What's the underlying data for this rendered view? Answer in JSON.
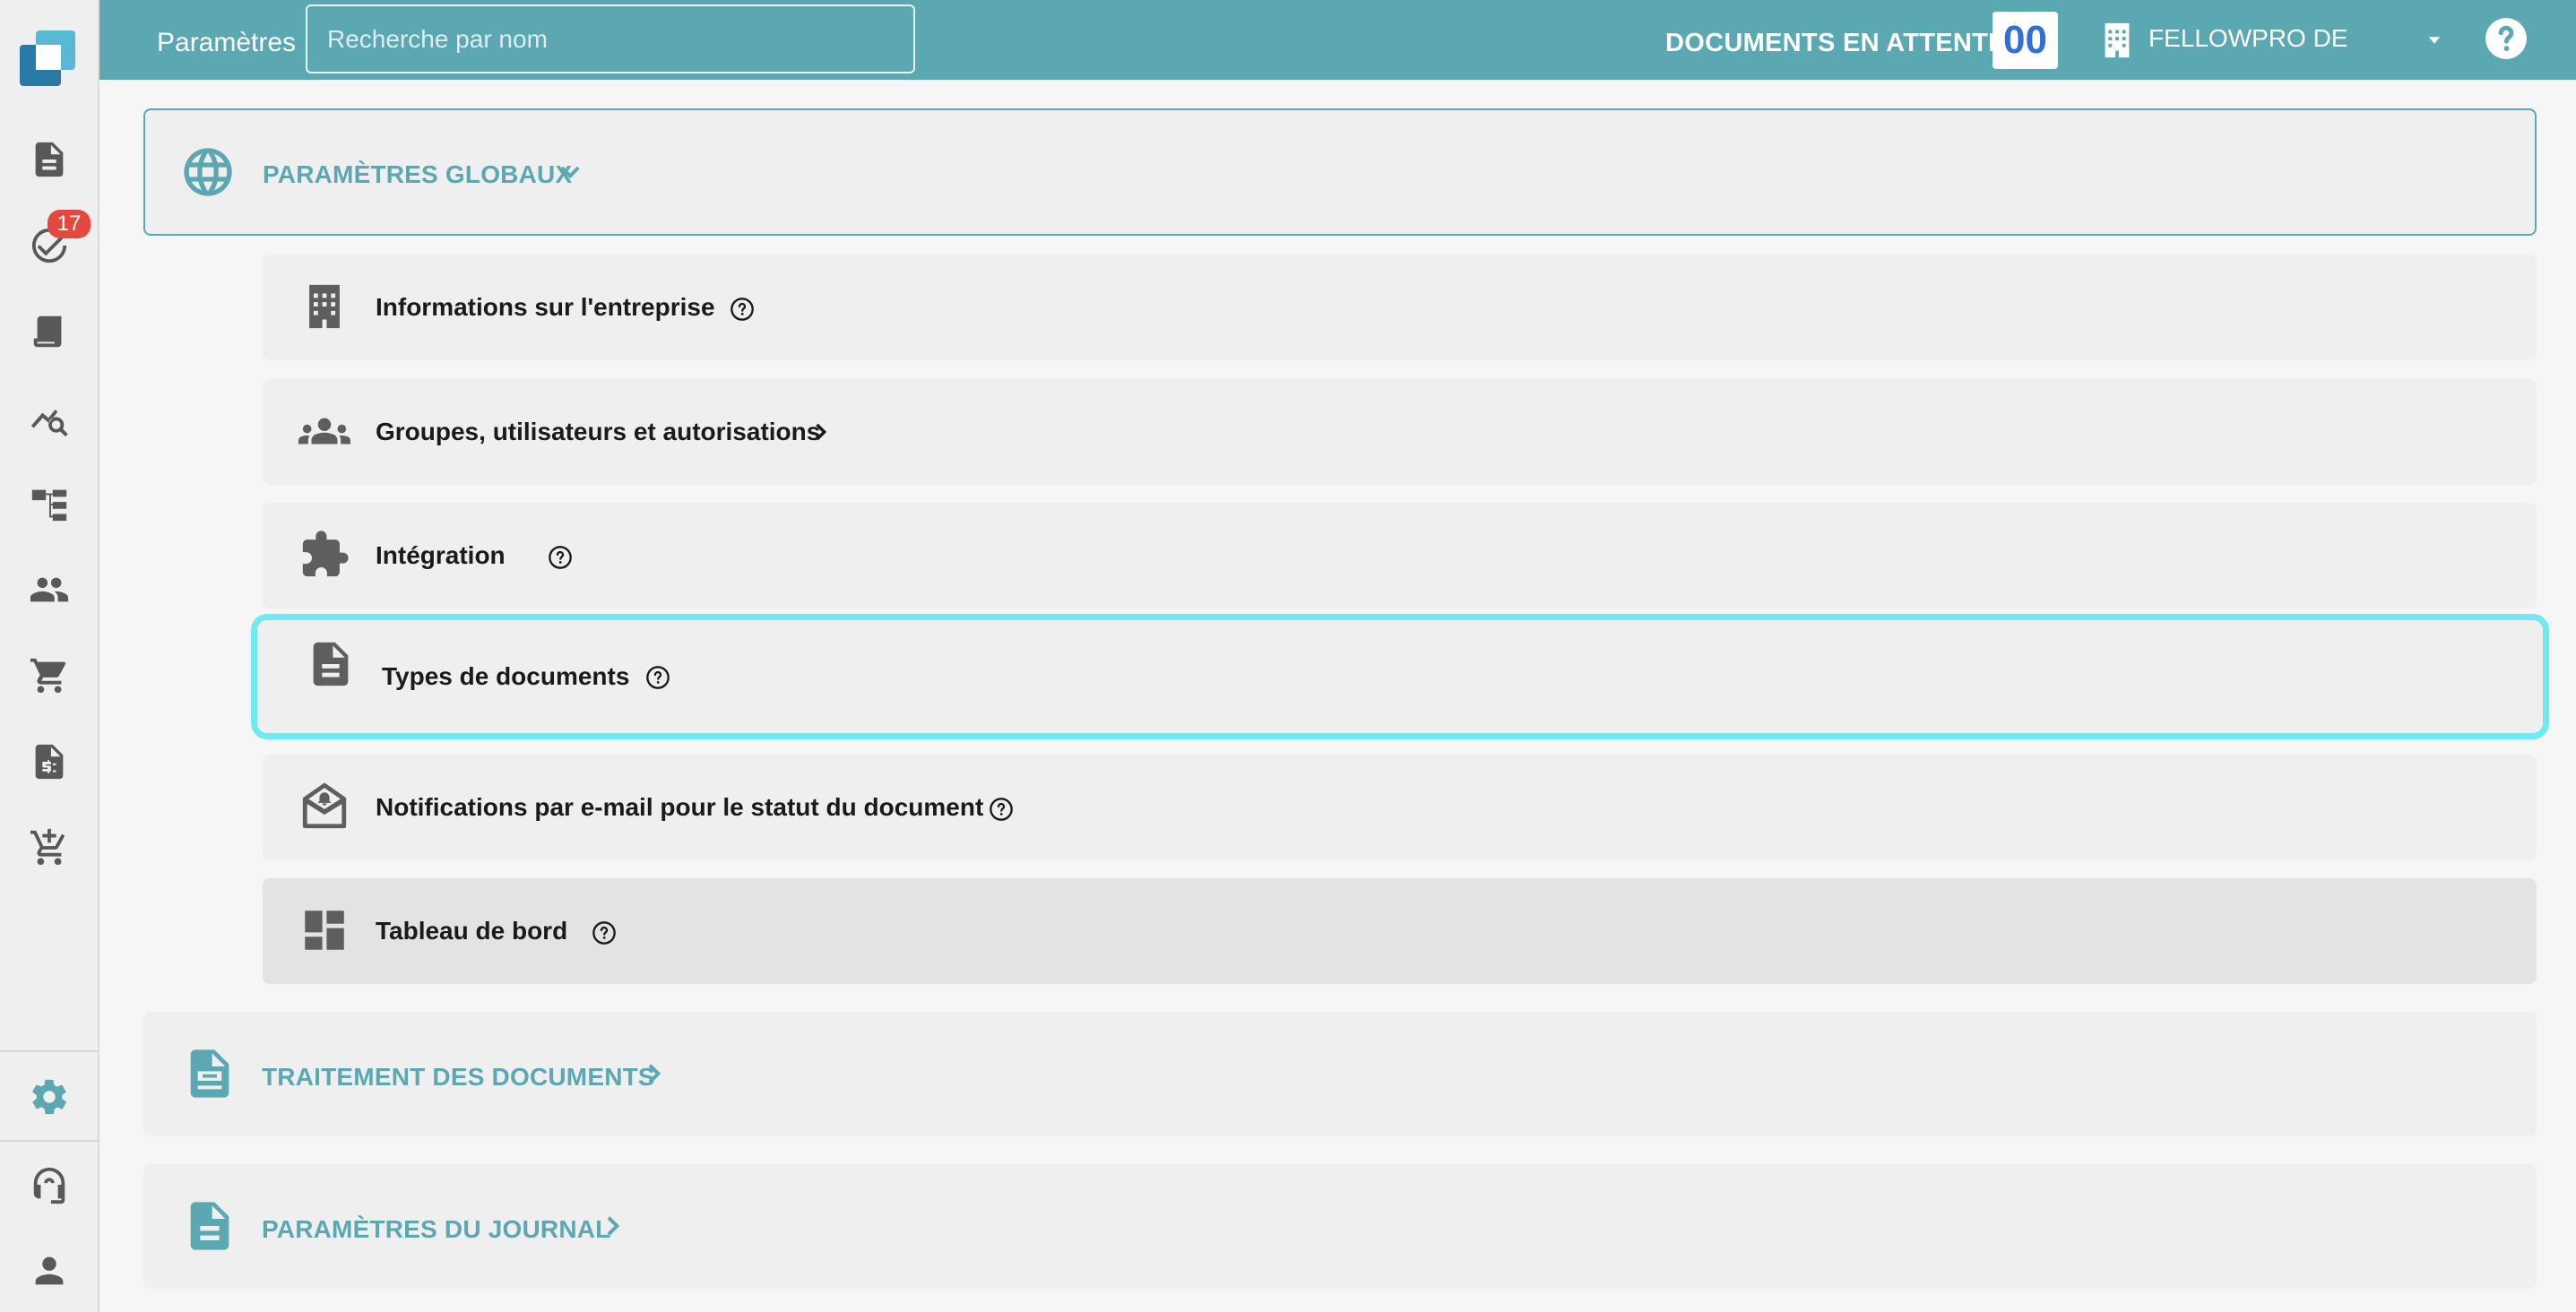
{
  "topbar": {
    "title": "Paramètres",
    "search_placeholder": "Recherche par nom",
    "pending_label": "DOCUMENTS EN ATTENTE:",
    "pending_count": "00",
    "company_name": "FELLOWPRO DE",
    "accent_color": "#5ba8b3"
  },
  "rail": {
    "badge_count": "17",
    "items": [
      {
        "icon": "document-icon"
      },
      {
        "icon": "check-circle-icon"
      },
      {
        "icon": "receipt-icon"
      },
      {
        "icon": "analytics-icon"
      },
      {
        "icon": "hierarchy-icon"
      },
      {
        "icon": "people-icon"
      },
      {
        "icon": "cart-icon"
      },
      {
        "icon": "invoice-icon"
      },
      {
        "icon": "cart-add-icon"
      },
      {
        "icon": "settings-icon"
      },
      {
        "icon": "support-icon"
      },
      {
        "icon": "user-icon"
      }
    ]
  },
  "sections": {
    "global": {
      "label": "PARAMÈTRES GLOBAUX",
      "items": [
        {
          "label": "Informations sur l'entreprise",
          "icon": "building-icon"
        },
        {
          "label": "Groupes, utilisateurs et autorisations",
          "icon": "groups-icon"
        },
        {
          "label": "Intégration",
          "icon": "puzzle-icon"
        },
        {
          "label": "Types de documents",
          "icon": "document-icon"
        },
        {
          "label": "Notifications par e-mail pour le statut du document",
          "icon": "mail-alert-icon"
        },
        {
          "label": "Tableau de bord",
          "icon": "dashboard-icon"
        }
      ]
    },
    "processing": {
      "label": "TRAITEMENT DES DOCUMENTS"
    },
    "journal": {
      "label": "PARAMÈTRES DU JOURNAL"
    }
  },
  "highlight_color": "#6fe9f2"
}
